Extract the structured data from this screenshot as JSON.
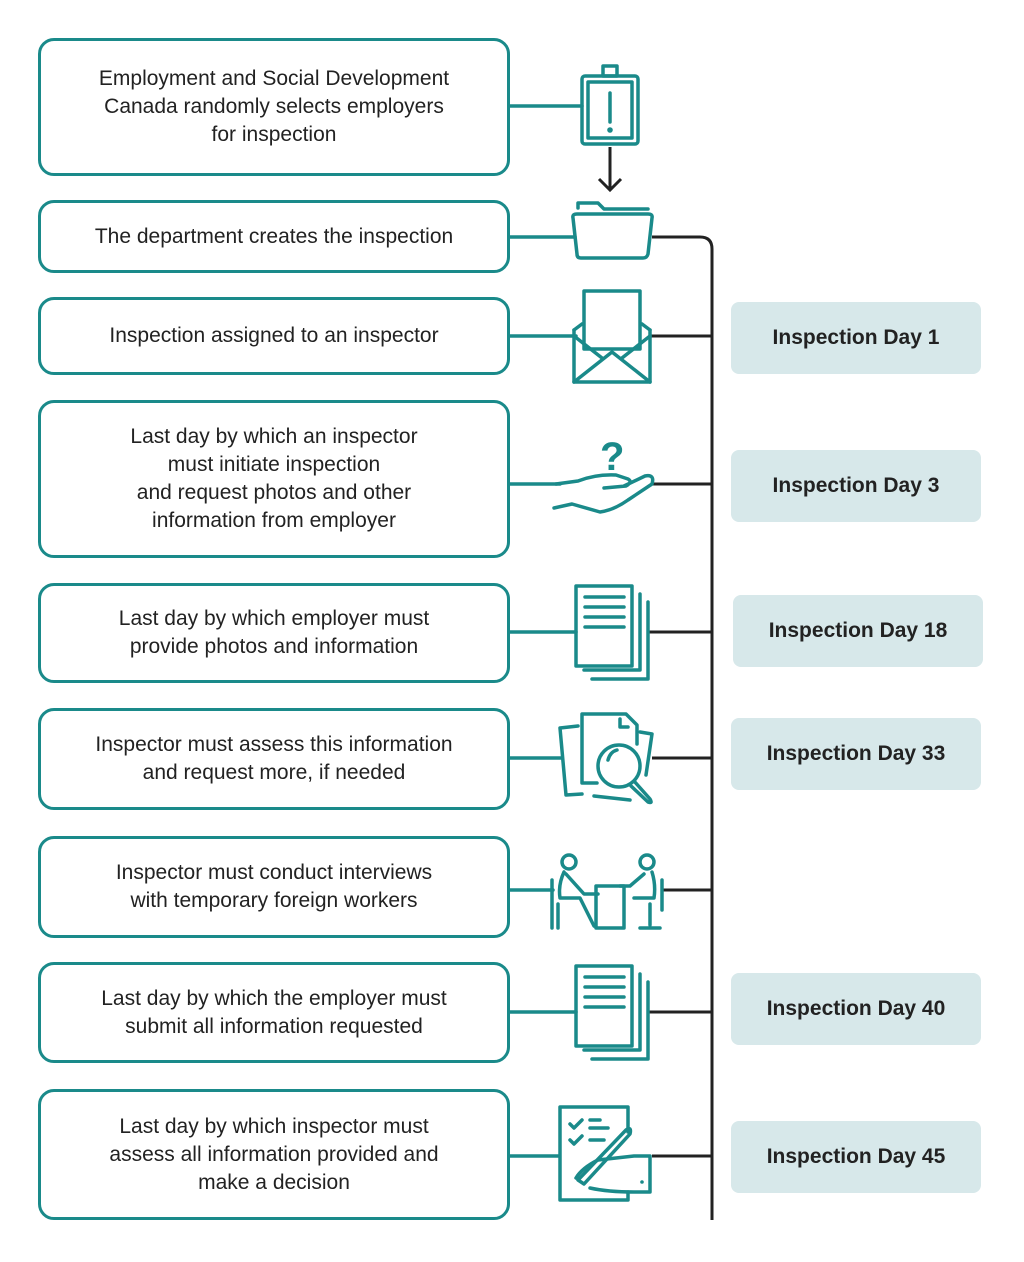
{
  "colors": {
    "accent": "#1a8a8a",
    "badge_bg": "#d7e8ea",
    "connector": "#222222",
    "text": "#222222"
  },
  "steps": [
    {
      "text": "Employment and Social Development\nCanada randomly selects employers\nfor inspection",
      "icon": "clipboard-alert-icon",
      "day": null
    },
    {
      "text": "The department creates the inspection",
      "icon": "folder-icon",
      "day": null
    },
    {
      "text": "Inspection assigned to an inspector",
      "icon": "envelope-icon",
      "day": "Inspection Day 1"
    },
    {
      "text": "Last day by which an inspector\nmust initiate inspection\nand request photos and other\ninformation from employer",
      "icon": "hand-question-icon",
      "day": "Inspection Day 3"
    },
    {
      "text": "Last day by which employer must\nprovide photos and information",
      "icon": "documents-icon",
      "day": "Inspection Day 18"
    },
    {
      "text": "Inspector must assess this information\nand request more, if needed",
      "icon": "document-search-icon",
      "day": "Inspection Day 33"
    },
    {
      "text": "Inspector must conduct interviews\nwith temporary foreign workers",
      "icon": "interview-icon",
      "day": null
    },
    {
      "text": "Last day by which the employer must\nsubmit all information requested",
      "icon": "documents-icon",
      "day": "Inspection Day 40"
    },
    {
      "text": "Last day by which inspector must\nassess all information provided and\nmake a decision",
      "icon": "sign-checklist-icon",
      "day": "Inspection Day 45"
    }
  ]
}
